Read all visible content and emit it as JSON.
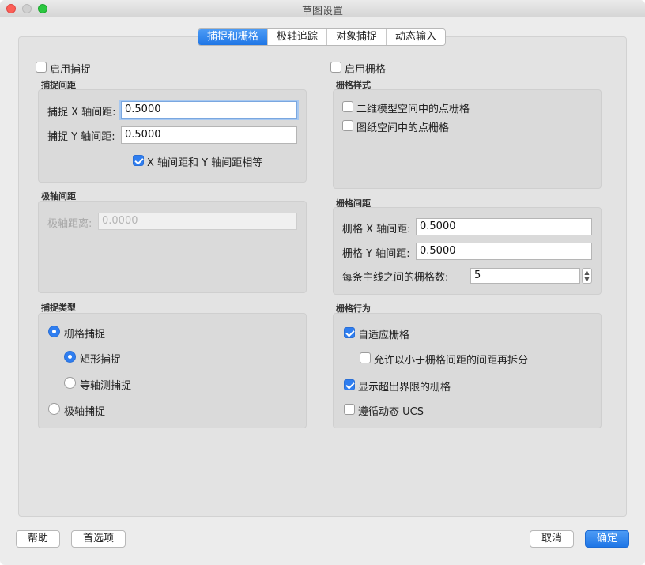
{
  "window": {
    "title": "草图设置"
  },
  "tabs": [
    {
      "label": "捕捉和栅格",
      "active": true
    },
    {
      "label": "极轴追踪",
      "active": false
    },
    {
      "label": "对象捕捉",
      "active": false
    },
    {
      "label": "动态输入",
      "active": false
    }
  ],
  "snap": {
    "enable_label": "启用捕捉",
    "enabled": false,
    "spacing_title": "捕捉间距",
    "x_label": "捕捉 X 轴间距:",
    "x_value": "0.5000",
    "y_label": "捕捉 Y 轴间距:",
    "y_value": "0.5000",
    "equal_label": "X 轴间距和 Y 轴间距相等",
    "equal_checked": true,
    "polar_title": "极轴间距",
    "polar_label": "极轴距离:",
    "polar_placeholder": "0.0000",
    "type_title": "捕捉类型",
    "type_grid": "栅格捕捉",
    "type_rect": "矩形捕捉",
    "type_iso": "等轴测捕捉",
    "type_polar": "极轴捕捉"
  },
  "grid": {
    "enable_label": "启用栅格",
    "enabled": false,
    "style_title": "栅格样式",
    "style_2d": "二维模型空间中的点栅格",
    "style_paper": "图纸空间中的点栅格",
    "spacing_title": "栅格间距",
    "x_label": "栅格 X 轴间距:",
    "x_value": "0.5000",
    "y_label": "栅格 Y 轴间距:",
    "y_value": "0.5000",
    "major_label": "每条主线之间的栅格数:",
    "major_value": "5",
    "behavior_title": "栅格行为",
    "adaptive_label": "自适应栅格",
    "adaptive_checked": true,
    "subdivide_label": "允许以小于栅格间距的间距再拆分",
    "subdivide_checked": false,
    "beyond_label": "显示超出界限的栅格",
    "beyond_checked": true,
    "ucs_label": "遵循动态 UCS",
    "ucs_checked": false
  },
  "buttons": {
    "help": "帮助",
    "options": "首选项",
    "cancel": "取消",
    "ok": "确定"
  },
  "colors": {
    "accent": "#2f7ef0",
    "close": "#fc5f57",
    "maximize": "#2bc840"
  }
}
